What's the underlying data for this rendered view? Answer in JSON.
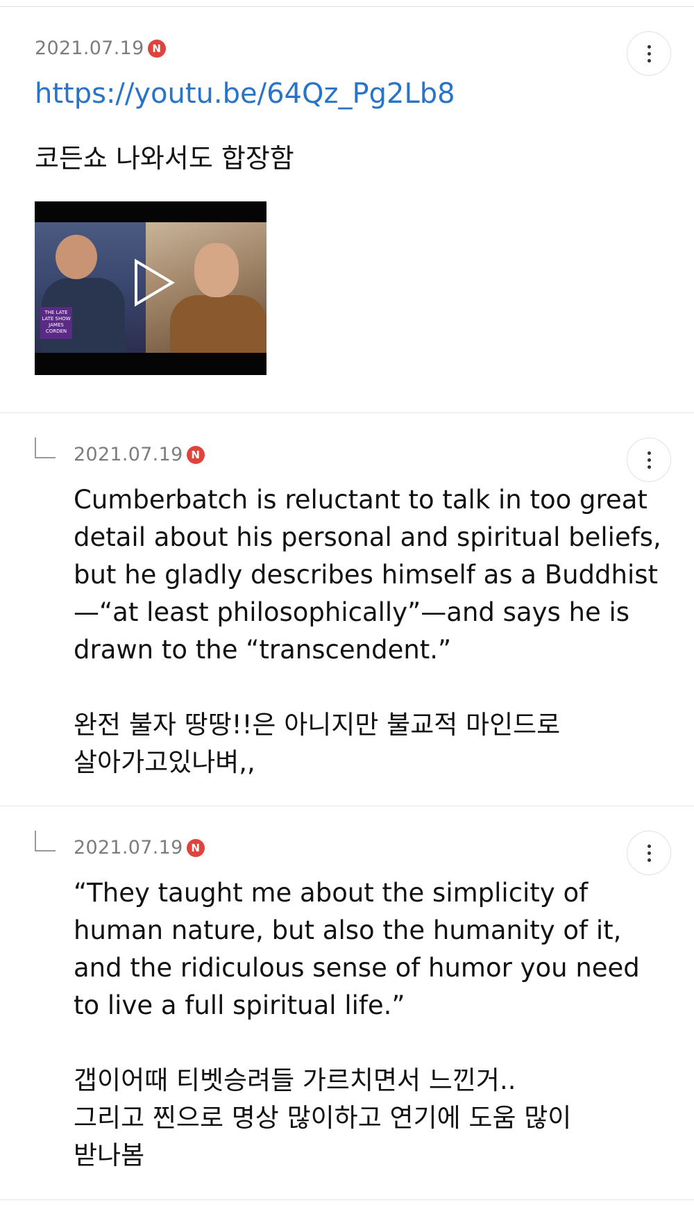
{
  "comments": [
    {
      "date": "2021.07.19",
      "badge": "N",
      "link": "https://youtu.be/64Qz_Pg2Lb8",
      "text": "코든쇼 나와서도 합장함",
      "video": {
        "logo_text": "THE LATE LATE SHOW JAMES CORDEN"
      }
    },
    {
      "date": "2021.07.19",
      "badge": "N",
      "text": "Cumberbatch is reluctant to talk in too great\ndetail about his personal and spiritual beliefs,\nbut he gladly describes himself as a Buddhist\n—“at least philosophically”—and says he is\ndrawn to the “transcendent.”\n\n완전 불자 땅땅!!은 아니지만 불교적 마인드로\n살아가고있나벼,,"
    },
    {
      "date": "2021.07.19",
      "badge": "N",
      "text": "“They taught me about the simplicity of\nhuman nature, but also the humanity of it,\nand the ridiculous sense of humor you need\nto live a full spiritual life.”\n\n갭이어때 티벳승려들 가르치면서 느낀거..\n그리고 찐으로 명상 많이하고 연기에 도움 많이\n받나봄"
    }
  ]
}
